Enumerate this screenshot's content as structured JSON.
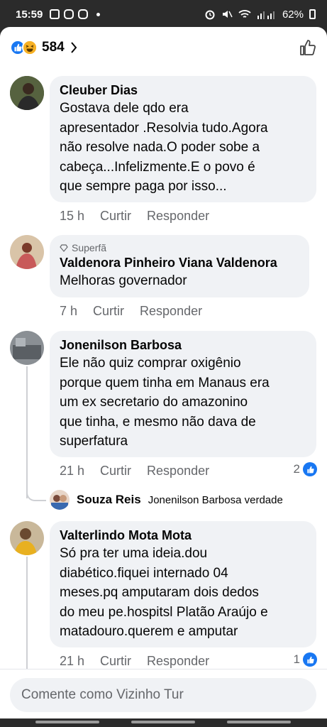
{
  "status_bar": {
    "time": "15:59",
    "battery": "62%",
    "icons": [
      "gallery-icon",
      "instagram-icon",
      "instagram-icon",
      "alarm-icon",
      "mute-icon",
      "wifi-icon",
      "signal-icon",
      "battery-icon"
    ]
  },
  "header": {
    "reaction_count": "584",
    "reactions": [
      "like",
      "haha"
    ]
  },
  "comments": [
    {
      "name": "Cleuber Dias",
      "lines": [
        "Gostava dele qdo era",
        "apresentador .Resolvia tudo.Agora",
        "não resolve nada.O poder sobe a",
        "cabeça...Infelizmente.E o povo é",
        "que sempre paga por isso..."
      ],
      "time": "15 h",
      "like_label": "Curtir",
      "reply_label": "Responder"
    },
    {
      "badge": "Superfã",
      "name": "Valdenora Pinheiro Viana Valdenora",
      "lines": [
        "Melhoras  governador"
      ],
      "time": "7 h",
      "like_label": "Curtir",
      "reply_label": "Responder"
    },
    {
      "name": "Jonenilson Barbosa",
      "lines": [
        "Ele não quiz comprar oxigênio",
        "porque quem tinha em Manaus era",
        "um ex secretario do amazonino",
        "que tinha, e mesmo não dava de",
        "superfatura"
      ],
      "time": "21 h",
      "like_label": "Curtir",
      "reply_label": "Responder",
      "likes": "2",
      "reply": {
        "name": "Souza Reis",
        "text": "Jonenilson Barbosa verdade"
      }
    },
    {
      "name": "Valterlindo Mota Mota",
      "lines": [
        "Só pra ter uma ideia.dou",
        "diabético.fiquei internado 04",
        "meses.pq amputaram dois dedos",
        "do meu pe.hospitsl Platão Araújo e",
        "matadouro.querem e amputar"
      ],
      "time": "21 h",
      "like_label": "Curtir",
      "reply_label": "Responder",
      "likes": "1"
    }
  ],
  "composer": {
    "placeholder": "Comente como Vizinho Tur"
  },
  "colors": {
    "accent": "#1877f2",
    "bubble": "#f0f2f5",
    "secondary_text": "#65676b"
  }
}
